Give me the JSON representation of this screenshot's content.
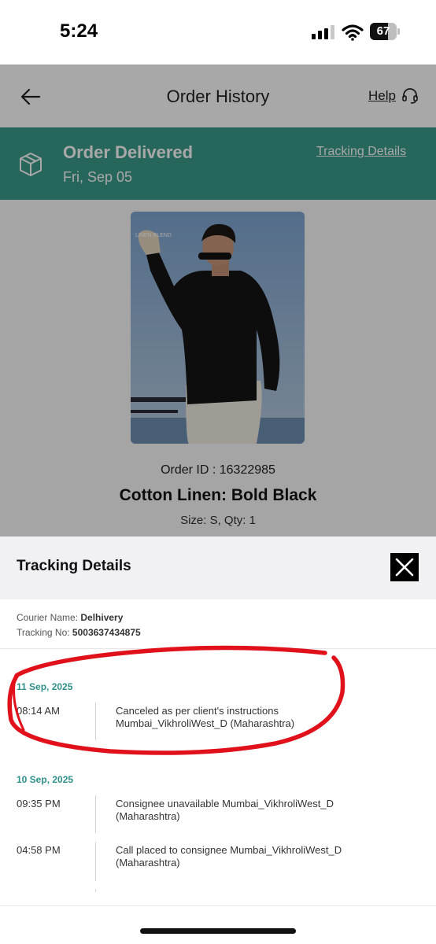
{
  "status_bar": {
    "time": "5:24",
    "battery": "67",
    "battery_level": 0.67
  },
  "header": {
    "title": "Order History",
    "help": "Help",
    "back_icon": "arrow-left-icon",
    "help_icon": "headset-icon"
  },
  "banner": {
    "status": "Order Delivered",
    "date": "Fri, Sep 05",
    "tracking_link": "Tracking Details",
    "icon": "package-box-icon",
    "color": "#3c9b8b"
  },
  "product": {
    "image_label": "LINEN BLEND",
    "order_id": "Order ID : 16322985",
    "name": "Cotton Linen: Bold Black",
    "size_qty": "Size: S, Qty: 1"
  },
  "sheet": {
    "title": "Tracking Details",
    "close_icon": "close-icon",
    "courier_label": "Courier Name:",
    "courier_value": "Delhivery",
    "tracking_label": "Tracking No:",
    "tracking_value": "5003637434875",
    "days": [
      {
        "date": "11 Sep, 2025",
        "events": [
          {
            "time": "08:14 AM",
            "desc": "Canceled as per client's instructions Mumbai_VikhroliWest_D (Maharashtra)"
          }
        ]
      },
      {
        "date": "10 Sep, 2025",
        "events": [
          {
            "time": "09:35 PM",
            "desc": "Consignee unavailable Mumbai_VikhroliWest_D (Maharashtra)"
          },
          {
            "time": "04:58 PM",
            "desc": "Call placed to consignee Mumbai_VikhroliWest_D (Maharashtra)"
          }
        ]
      }
    ]
  },
  "colors": {
    "accent": "#2f8f8a",
    "annotation": "#e0111b"
  }
}
